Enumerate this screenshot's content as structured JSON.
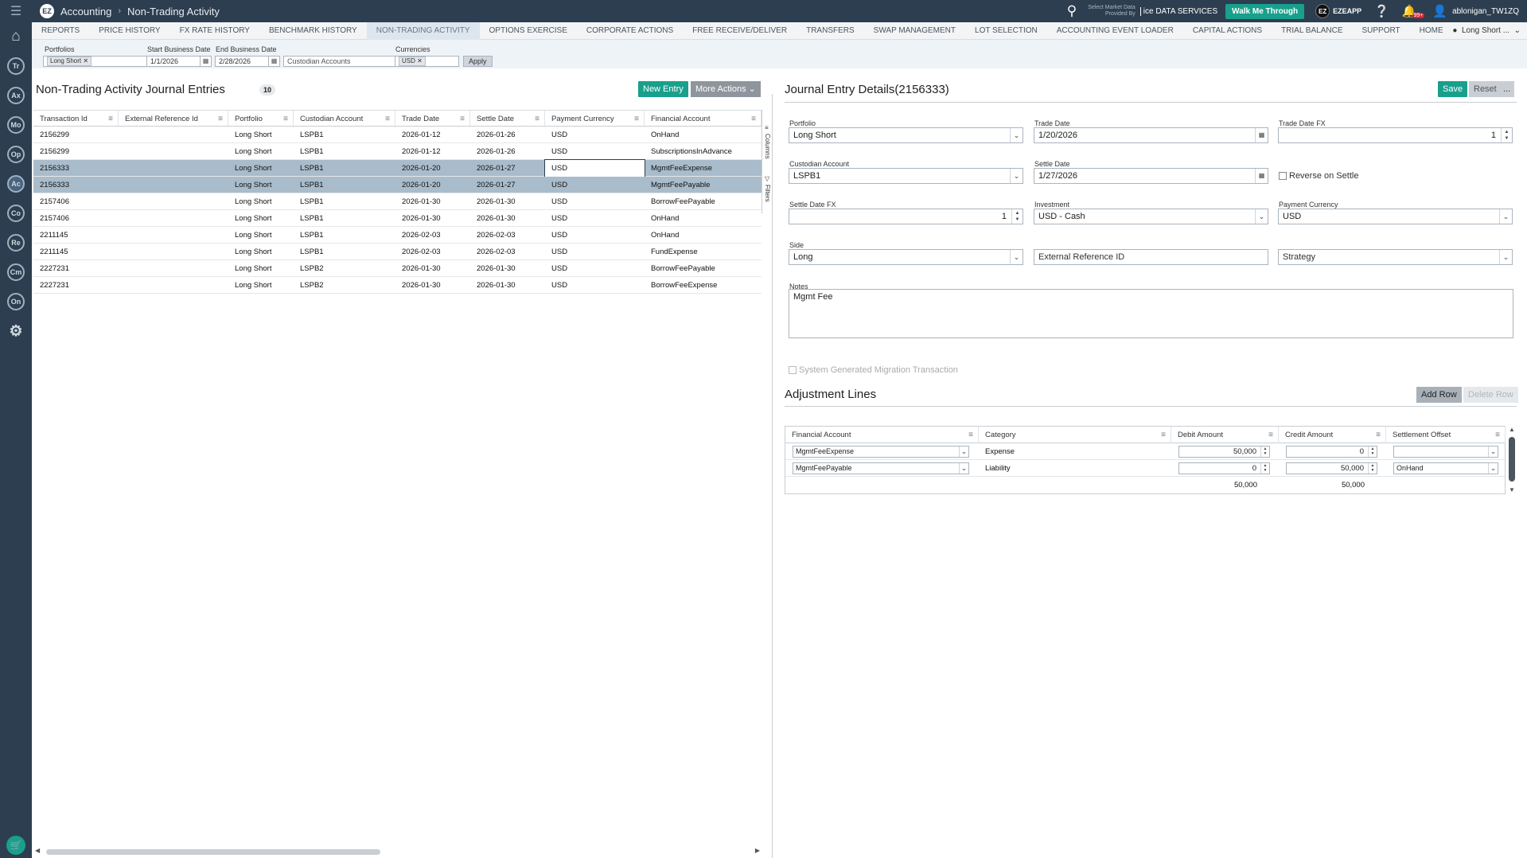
{
  "sidebar": {
    "menu_icon": "menu-icon",
    "items": [
      {
        "label": "Tr"
      },
      {
        "label": "Ax"
      },
      {
        "label": "Mo"
      },
      {
        "label": "Op"
      },
      {
        "label": "Ac"
      },
      {
        "label": "Co"
      },
      {
        "label": "Re"
      },
      {
        "label": "Cm"
      },
      {
        "label": "On"
      }
    ]
  },
  "header": {
    "logo": "EZ",
    "app": "Accounting",
    "page": "Non-Trading Activity",
    "market_line1": "Select Market Data",
    "market_line2": "Provided By",
    "ice_label": "ice DATA SERVICES",
    "walk_button": "Walk Me Through",
    "eze_label": "EZEAPP",
    "notif_count": "99+",
    "user": "ablonigan_TW1ZQ"
  },
  "nav": {
    "items": [
      "REPORTS",
      "PRICE HISTORY",
      "FX RATE HISTORY",
      "BENCHMARK HISTORY",
      "NON-TRADING ACTIVITY",
      "OPTIONS EXERCISE",
      "CORPORATE ACTIONS",
      "FREE RECEIVE/DELIVER",
      "TRANSFERS",
      "SWAP MANAGEMENT",
      "LOT SELECTION",
      "ACCOUNTING EVENT LOADER",
      "CAPITAL ACTIONS",
      "TRIAL BALANCE",
      "SUPPORT",
      "HOME"
    ],
    "active": "NON-TRADING ACTIVITY",
    "right_label": "Long Short ..."
  },
  "filters": {
    "portfolios_label": "Portfolios",
    "portfolio_chip": "Long Short",
    "start_label": "Start Business Date",
    "start_value": "1/1/2026",
    "end_label": "End Business Date",
    "end_value": "2/28/2026",
    "custodian_placeholder": "Custodian Accounts",
    "currencies_label": "Currencies",
    "currency_chip": "USD",
    "apply": "Apply"
  },
  "left": {
    "title": "Non-Trading Activity Journal Entries",
    "count": "10",
    "new_entry": "New Entry",
    "more_actions": "More Actions",
    "columns": [
      "Transaction Id",
      "External Reference Id",
      "Portfolio",
      "Custodian Account",
      "Trade Date",
      "Settle Date",
      "Payment Currency",
      "Financial Account"
    ],
    "rows": [
      [
        "2156299",
        "",
        "Long Short",
        "LSPB1",
        "2026-01-12",
        "2026-01-26",
        "USD",
        "OnHand"
      ],
      [
        "2156299",
        "",
        "Long Short",
        "LSPB1",
        "2026-01-12",
        "2026-01-26",
        "USD",
        "SubscriptionsInAdvance"
      ],
      [
        "2156333",
        "",
        "Long Short",
        "LSPB1",
        "2026-01-20",
        "2026-01-27",
        "USD",
        "MgmtFeeExpense"
      ],
      [
        "2156333",
        "",
        "Long Short",
        "LSPB1",
        "2026-01-20",
        "2026-01-27",
        "USD",
        "MgmtFeePayable"
      ],
      [
        "2157406",
        "",
        "Long Short",
        "LSPB1",
        "2026-01-30",
        "2026-01-30",
        "USD",
        "BorrowFeePayable"
      ],
      [
        "2157406",
        "",
        "Long Short",
        "LSPB1",
        "2026-01-30",
        "2026-01-30",
        "USD",
        "OnHand"
      ],
      [
        "2211145",
        "",
        "Long Short",
        "LSPB1",
        "2026-02-03",
        "2026-02-03",
        "USD",
        "OnHand"
      ],
      [
        "2211145",
        "",
        "Long Short",
        "LSPB1",
        "2026-02-03",
        "2026-02-03",
        "USD",
        "FundExpense"
      ],
      [
        "2227231",
        "",
        "Long Short",
        "LSPB2",
        "2026-01-30",
        "2026-01-30",
        "USD",
        "BorrowFeePayable"
      ],
      [
        "2227231",
        "",
        "Long Short",
        "LSPB2",
        "2026-01-30",
        "2026-01-30",
        "USD",
        "BorrowFeeExpense"
      ]
    ],
    "side_tabs": [
      "Columns",
      "Filters"
    ]
  },
  "detail": {
    "title": "Journal Entry Details(2156333)",
    "save": "Save",
    "reset": "Reset",
    "more": "...",
    "portfolio_label": "Portfolio",
    "portfolio_value": "Long Short",
    "trade_date_label": "Trade Date",
    "trade_date_value": "1/20/2026",
    "trade_fx_label": "Trade Date FX",
    "trade_fx_value": "1",
    "custodian_label": "Custodian Account",
    "custodian_value": "LSPB1",
    "settle_date_label": "Settle Date",
    "settle_date_value": "1/27/2026",
    "reverse_label": "Reverse on Settle",
    "settle_fx_label": "Settle Date FX",
    "settle_fx_value": "1",
    "investment_label": "Investment",
    "investment_value": "USD - Cash",
    "pay_ccy_label": "Payment Currency",
    "pay_ccy_value": "USD",
    "side_label": "Side",
    "side_value": "Long",
    "ext_ref_placeholder": "External Reference ID",
    "strategy_placeholder": "Strategy",
    "notes_label": "Notes",
    "notes_value": "Mgmt Fee",
    "migration_label": "System Generated Migration Transaction"
  },
  "adjustments": {
    "title": "Adjustment Lines",
    "add_row": "Add Row",
    "delete_row": "Delete Row",
    "columns": [
      "Financial Account",
      "Category",
      "Debit Amount",
      "Credit Amount",
      "Settlement Offset"
    ],
    "rows": [
      {
        "account": "MgmtFeeExpense",
        "category": "Expense",
        "debit": "50,000",
        "credit": "0",
        "offset": ""
      },
      {
        "account": "MgmtFeePayable",
        "category": "Liability",
        "debit": "0",
        "credit": "50,000",
        "offset": "OnHand"
      }
    ],
    "total_debit": "50,000",
    "total_credit": "50,000"
  }
}
